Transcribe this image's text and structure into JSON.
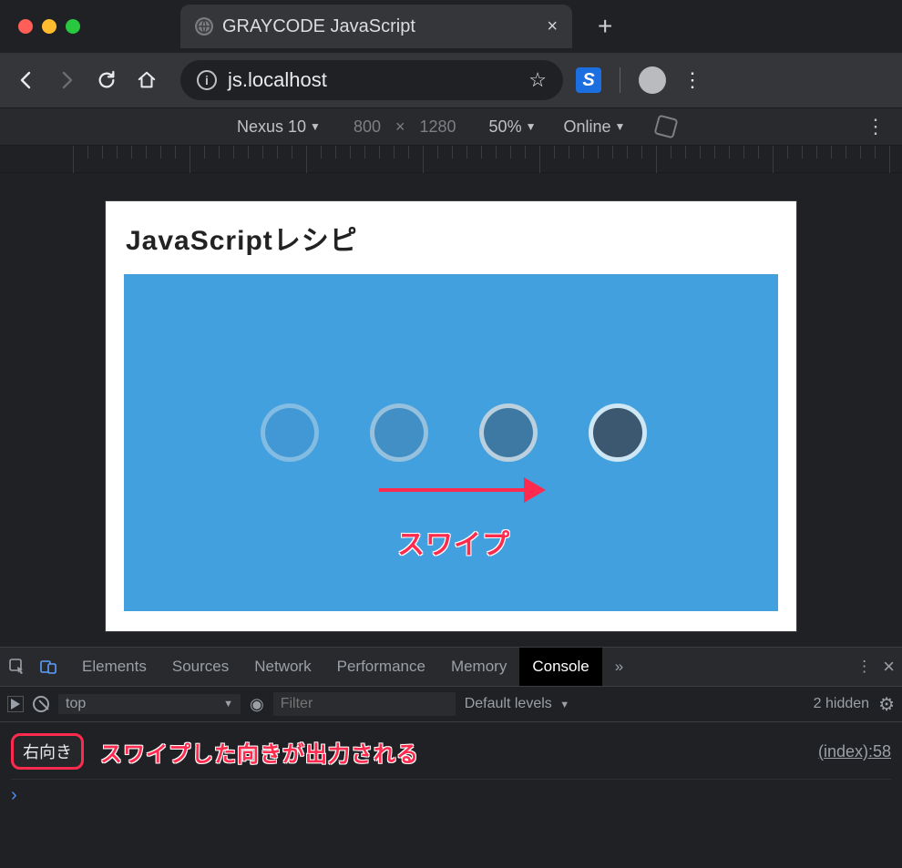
{
  "browser": {
    "tab_title": "GRAYCODE JavaScript",
    "url": "js.localhost",
    "new_tab_glyph": "+",
    "close_glyph": "×",
    "star_glyph": "☆",
    "kebab_glyph": "⋮"
  },
  "device_toolbar": {
    "device": "Nexus 10",
    "width": "800",
    "height": "1280",
    "zoom": "50%",
    "throttle": "Online",
    "dropdown_glyph": "▼",
    "times_glyph": "×"
  },
  "page": {
    "heading": "JavaScriptレシピ",
    "swipe_label": "スワイプ"
  },
  "devtools": {
    "tabs": {
      "elements": "Elements",
      "sources": "Sources",
      "network": "Network",
      "performance": "Performance",
      "memory": "Memory",
      "console": "Console",
      "more": "»"
    },
    "filter": {
      "context": "top",
      "placeholder": "Filter",
      "levels": "Default levels",
      "hidden": "2 hidden"
    },
    "log": {
      "message": "右向き",
      "annotation": "スワイプした向きが出力される",
      "source": "(index):58"
    },
    "prompt_glyph": "›"
  }
}
